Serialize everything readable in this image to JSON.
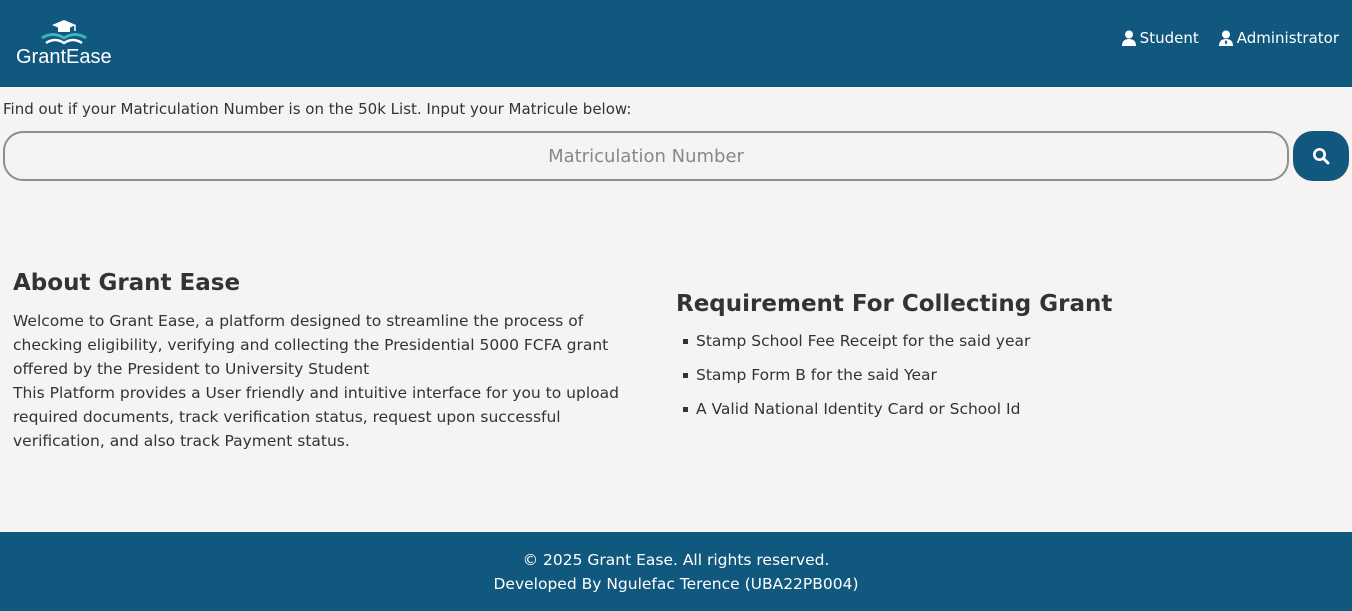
{
  "header": {
    "logo_text": "GrantEase",
    "nav": [
      {
        "label": "Student",
        "icon": "user-icon"
      },
      {
        "label": "Administrator",
        "icon": "user-tie-icon"
      }
    ]
  },
  "search": {
    "prompt": "Find out if your Matriculation Number is on the 50k List. Input your Matricule below:",
    "value": "",
    "placeholder": "Matriculation Number",
    "button_icon": "search-icon"
  },
  "about": {
    "title": "About Grant Ease",
    "paragraphs": [
      "Welcome to Grant Ease, a platform designed to streamline the process of checking eligibility, verifying and collecting the Presidential 5000 FCFA grant offered by the President to University Student",
      "This Platform provides a User friendly and intuitive interface for you to upload required documents, track verification status, request upon successful verification, and also track Payment status."
    ]
  },
  "requirements": {
    "title": "Requirement For Collecting Grant",
    "items": [
      "Stamp School Fee Receipt for the said year",
      "Stamp Form B for the said Year",
      "A Valid National Identity Card or School Id"
    ]
  },
  "footer": {
    "copyright": "© 2025 Grant Ease. All rights reserved.",
    "developer": "Developed By Ngulefac Terence (UBA22PB004)"
  },
  "colors": {
    "primary": "#11587f",
    "background": "#f5f4f2",
    "logo_accent": "#3fb3c4"
  }
}
